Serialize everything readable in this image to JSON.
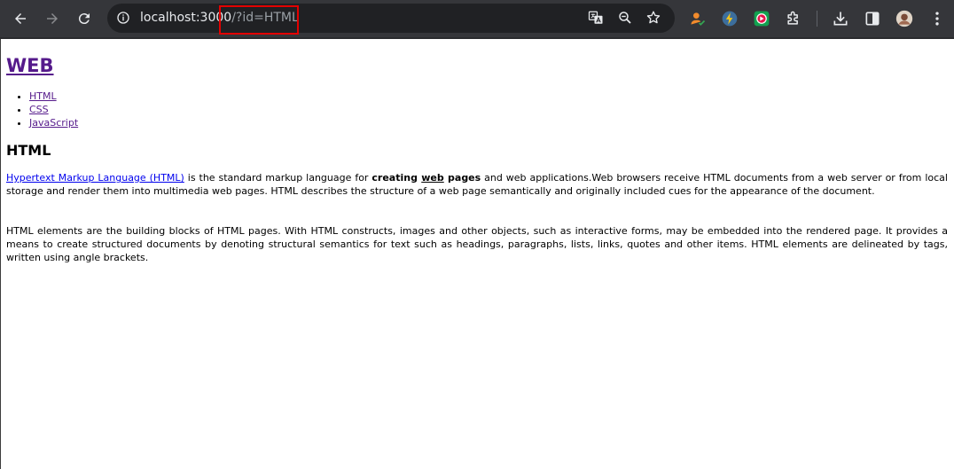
{
  "browser": {
    "url_host": "localhost:3000",
    "url_path": "/?id=HTML",
    "colors": {
      "toolbar": "#35363a",
      "omnibox": "#202124",
      "highlight": "#e30000"
    }
  },
  "page": {
    "site_title": "WEB",
    "nav_items": [
      "HTML",
      "CSS",
      "JavaScript"
    ],
    "article_title": "HTML",
    "paragraph1": {
      "link_text": "Hypertext Markup Language (HTML)",
      "text_a": " is the standard markup language for ",
      "bold_1": "creating",
      "space_1": " ",
      "bold_underlined": "web",
      "space_2": " ",
      "bold_2": "pages",
      "text_b": " and web applications.Web browsers receive HTML documents from a web server or from local storage and render them into multimedia web pages. HTML describes the structure of a web page semantically and originally included cues for the appearance of the document."
    },
    "paragraph2": "HTML elements are the building blocks of HTML pages. With HTML constructs, images and other objects, such as interactive forms, may be embedded into the rendered page. It provides a means to create structured documents by denoting structural semantics for text such as headings, paragraphs, lists, links, quotes and other items. HTML elements are delineated by tags, written using angle brackets.",
    "colors": {
      "link_visited": "#551a8b",
      "link": "#0000ee"
    }
  }
}
